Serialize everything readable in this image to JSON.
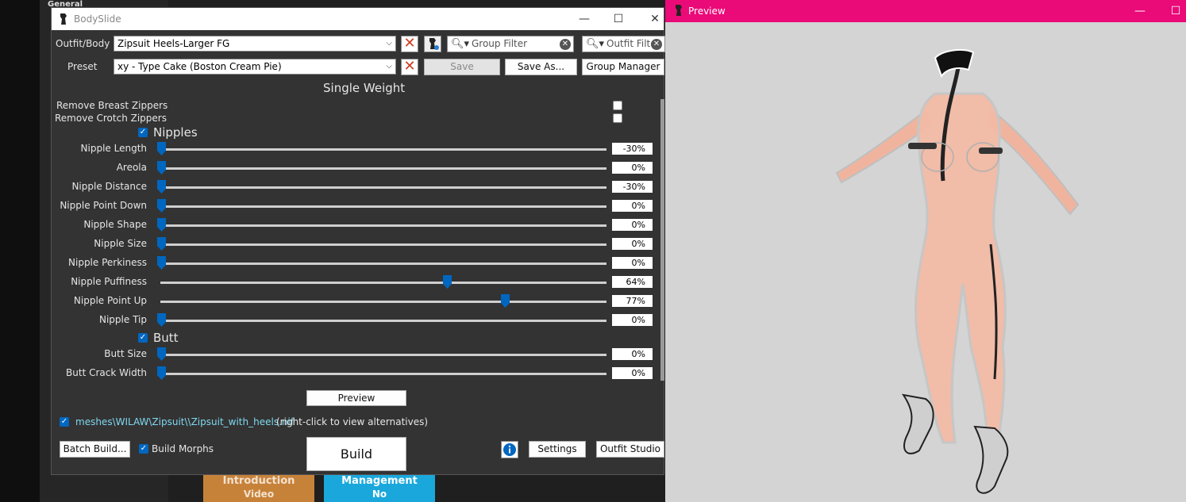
{
  "background": {
    "general_label": "General",
    "tiles": [
      {
        "line1": "Introduction",
        "line2": "Video",
        "color": "#c7823a"
      },
      {
        "line1": "Management",
        "line2": "No",
        "color": "#1aa8dc"
      }
    ]
  },
  "bodyslide": {
    "title": "BodySlide",
    "window_controls": {
      "minimize": "—",
      "maximize": "☐",
      "close": "✕"
    },
    "outfit_label": "Outfit/Body",
    "outfit_value": "Zipsuit Heels-Larger FG",
    "preset_label": "Preset",
    "preset_value": "xy - Type Cake (Boston Cream Pie)",
    "group_filter_placeholder": "Group Filter",
    "outfit_filter_placeholder": "Outfit Filter",
    "buttons": {
      "save": "Save",
      "save_as": "Save As...",
      "group_manager": "Group Manager",
      "preview": "Preview",
      "batch_build": "Batch Build...",
      "build": "Build",
      "settings": "Settings",
      "outfit_studio": "Outfit Studio"
    },
    "mode_title": "Single Weight",
    "zipper_options": [
      {
        "label": "Remove Breast Zippers",
        "checked": false
      },
      {
        "label": "Remove Crotch Zippers",
        "checked": false
      }
    ],
    "groups": [
      {
        "name": "Nipples",
        "checked": true,
        "sliders": [
          {
            "label": "Nipple Length",
            "value": "-30%",
            "position": 0.0
          },
          {
            "label": "Areola",
            "value": "0%",
            "position": 0.0
          },
          {
            "label": "Nipple Distance",
            "value": "-30%",
            "position": 0.0
          },
          {
            "label": "Nipple Point Down",
            "value": "0%",
            "position": 0.0
          },
          {
            "label": "Nipple Shape",
            "value": "0%",
            "position": 0.0
          },
          {
            "label": "Nipple Size",
            "value": "0%",
            "position": 0.0
          },
          {
            "label": "Nipple Perkiness",
            "value": "0%",
            "position": 0.0
          },
          {
            "label": "Nipple Puffiness",
            "value": "64%",
            "position": 0.64
          },
          {
            "label": "Nipple Point Up",
            "value": "77%",
            "position": 0.77
          },
          {
            "label": "Nipple Tip",
            "value": "0%",
            "position": 0.0
          }
        ]
      },
      {
        "name": "Butt",
        "checked": true,
        "sliders": [
          {
            "label": "Butt Size",
            "value": "0%",
            "position": 0.0
          },
          {
            "label": "Butt Crack Width",
            "value": "0%",
            "position": 0.0
          }
        ]
      }
    ],
    "output_path": "meshes\\WILAW\\Zipsuit\\\\Zipsuit_with_heels.nif",
    "output_path_checked": true,
    "output_path_note": "(right-click to view alternatives)",
    "build_morphs_label": "Build Morphs",
    "build_morphs_checked": true,
    "accent_color": "#0067c0"
  },
  "preview": {
    "title": "Preview",
    "titlebar_color": "#ea0a78",
    "window_controls": {
      "minimize": "—",
      "maximize": "☐"
    }
  }
}
